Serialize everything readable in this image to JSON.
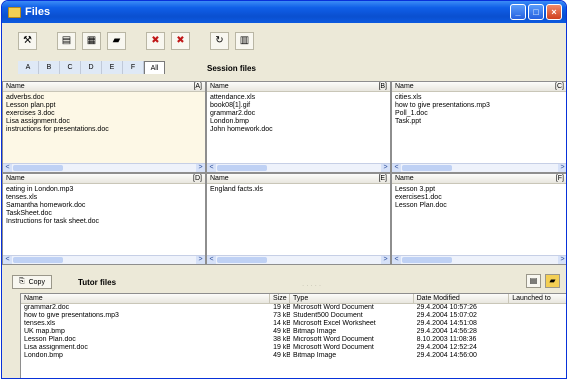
{
  "window": {
    "title": "Files"
  },
  "window_controls": [
    "_",
    "□",
    "×"
  ],
  "toolbar": {
    "icons": [
      "tools-icon",
      "page-icon",
      "document-icon",
      "folder-icon",
      "delete-icon",
      "delete-all-icon",
      "refresh-icon",
      "trash-icon"
    ]
  },
  "tabs": [
    "A",
    "B",
    "C",
    "D",
    "E",
    "F",
    "All"
  ],
  "session": {
    "title": "Session files",
    "panes": [
      {
        "label": "[A]",
        "header": "Name",
        "files": [
          "adverbs.doc",
          "Lesson plan.ppt",
          "exercises 3.doc",
          "Lisa assignment.doc",
          "instructions for presentations.doc"
        ]
      },
      {
        "label": "[B]",
        "header": "Name",
        "files": [
          "attendance.xls",
          "book08[1].gif",
          "grammar2.doc",
          "London.bmp",
          "John homework.doc"
        ]
      },
      {
        "label": "[C]",
        "header": "Name",
        "files": [
          "cities.xls",
          "how to give presentations.mp3",
          "Poll_1.doc",
          "Task.ppt"
        ]
      },
      {
        "label": "[D]",
        "header": "Name",
        "files": [
          "eating in London.mp3",
          "tenses.xls",
          "Samantha homework.doc",
          "TaskSheet.doc",
          "Instructions for task sheet.doc"
        ]
      },
      {
        "label": "[E]",
        "header": "Name",
        "files": [
          "England facts.xls"
        ]
      },
      {
        "label": "[F]",
        "header": "Name",
        "files": [
          "Lesson 3.ppt",
          "exercises1.doc",
          "Lesson Plan.doc"
        ]
      }
    ]
  },
  "tutor": {
    "copy_label": "Copy",
    "title": "Tutor files",
    "dots": ".....",
    "columns": [
      "Name",
      "Size",
      "Type",
      "Date Modified",
      "Launched to"
    ],
    "rows": [
      [
        "grammar2.doc",
        "19 kB",
        "Microsoft Word Document",
        "29.4.2004 10:57:26",
        ""
      ],
      [
        "how to give presentations.mp3",
        "73 kB",
        "Student500 Document",
        "29.4.2004 15:07:02",
        ""
      ],
      [
        "tenses.xls",
        "14 kB",
        "Microsoft Excel Worksheet",
        "29.4.2004 14:51:08",
        ""
      ],
      [
        "UK map.bmp",
        "49 kB",
        "Bitmap Image",
        "29.4.2004 14:56:28",
        ""
      ],
      [
        "Lesson Plan.doc",
        "38 kB",
        "Microsoft Word Document",
        "8.10.2003 11:08:36",
        ""
      ],
      [
        "Lisa assignment.doc",
        "19 kB",
        "Microsoft Word Document",
        "29.4.2004 12:52:24",
        ""
      ],
      [
        "London.bmp",
        "49 kB",
        "Bitmap Image",
        "29.4.2004 14:56:00",
        ""
      ]
    ]
  }
}
